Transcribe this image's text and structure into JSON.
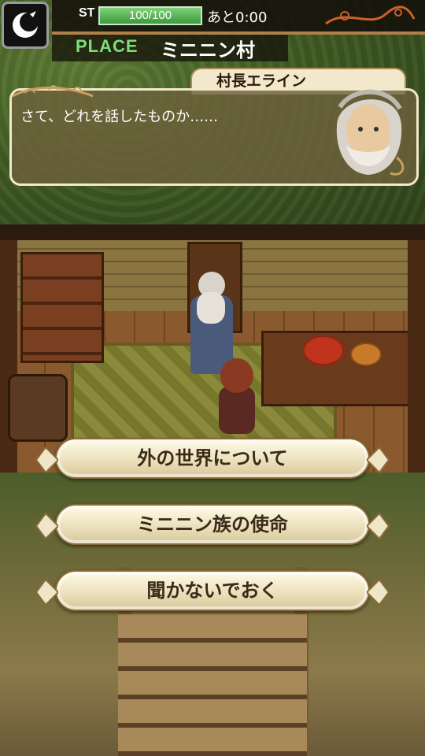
{
  "hud": {
    "st_label": "ST",
    "stamina_text": "100/100",
    "stamina_value": 100,
    "stamina_max": 100,
    "timer": "あと0:00",
    "place_label": "PLACE",
    "place_name": "ミニニン村"
  },
  "dialog": {
    "speaker": "村長エライン",
    "text": "さて、どれを話したものか……"
  },
  "choices": [
    {
      "label": "外の世界について"
    },
    {
      "label": "ミニニン族の使命"
    },
    {
      "label": "聞かないでおく"
    }
  ],
  "icons": {
    "menu": "crescent-moon-icon"
  },
  "colors": {
    "stamina_green": "#3a9a3a",
    "place_green": "#7be07a",
    "dialog_frame": "#f2e8cc",
    "choice_text": "#3a2a18"
  }
}
